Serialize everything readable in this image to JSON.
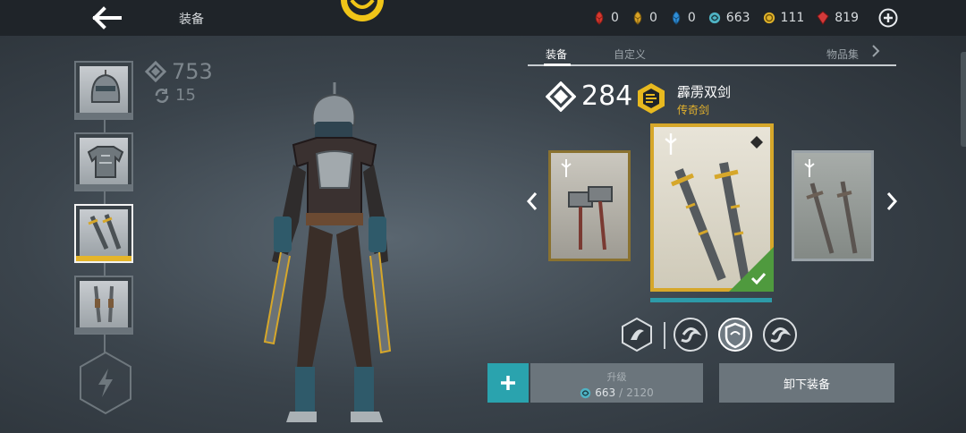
{
  "header": {
    "title": "装备",
    "currencies": [
      {
        "icon": "red-leaf-icon",
        "value": "0",
        "color": "#d8392f"
      },
      {
        "icon": "gold-leaf-icon",
        "value": "0",
        "color": "#d9a326"
      },
      {
        "icon": "blue-leaf-icon",
        "value": "0",
        "color": "#2f8fd8"
      },
      {
        "icon": "orb-icon",
        "value": "663",
        "color": "#4fb3c4"
      },
      {
        "icon": "coin-icon",
        "value": "111",
        "color": "#e0b22a"
      },
      {
        "icon": "gem-icon",
        "value": "819",
        "color": "#d33a3a"
      }
    ]
  },
  "left": {
    "stats": {
      "power": "753",
      "level": "15"
    },
    "slots": [
      {
        "name": "helmet"
      },
      {
        "name": "armor"
      },
      {
        "name": "weapon",
        "selected": true
      },
      {
        "name": "ranged"
      }
    ]
  },
  "tabs": [
    {
      "label": "装备",
      "active": true
    },
    {
      "label": "自定义"
    },
    {
      "label": "物品集"
    }
  ],
  "item": {
    "power": "284",
    "name": "霹雳双剑",
    "type": "传奇剑"
  },
  "actions": {
    "upgrade_label": "升级",
    "upgrade_have": "663",
    "upgrade_sep": "/",
    "upgrade_need": "2120",
    "unequip_label": "卸下装备",
    "plus": "+"
  },
  "colors": {
    "accent": "#2aa3ae",
    "legendary": "#d6a72a",
    "equipped": "#4f9a3e"
  }
}
